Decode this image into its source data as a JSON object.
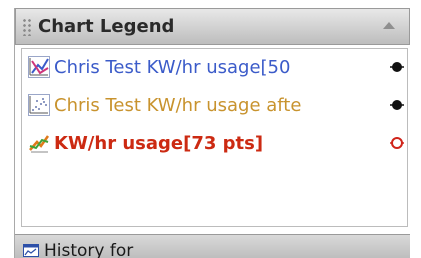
{
  "panel": {
    "title": "Chart Legend"
  },
  "legend": {
    "items": [
      {
        "label": "Chris Test KW/hr usage[50",
        "color": "#3b5bc9",
        "icon": "line-chart-icon",
        "marker": "black-dot-icon"
      },
      {
        "label": "Chris Test KW/hr usage afte",
        "color": "#c8932e",
        "icon": "scatter-chart-icon",
        "marker": "black-dot-icon"
      },
      {
        "label": "KW/hr usage[73 pts]",
        "color": "#cc2a12",
        "icon": "line-chart-icon",
        "marker": "red-ring-icon"
      }
    ]
  },
  "footer": {
    "label": "History for",
    "icon": "chart-window-icon"
  }
}
